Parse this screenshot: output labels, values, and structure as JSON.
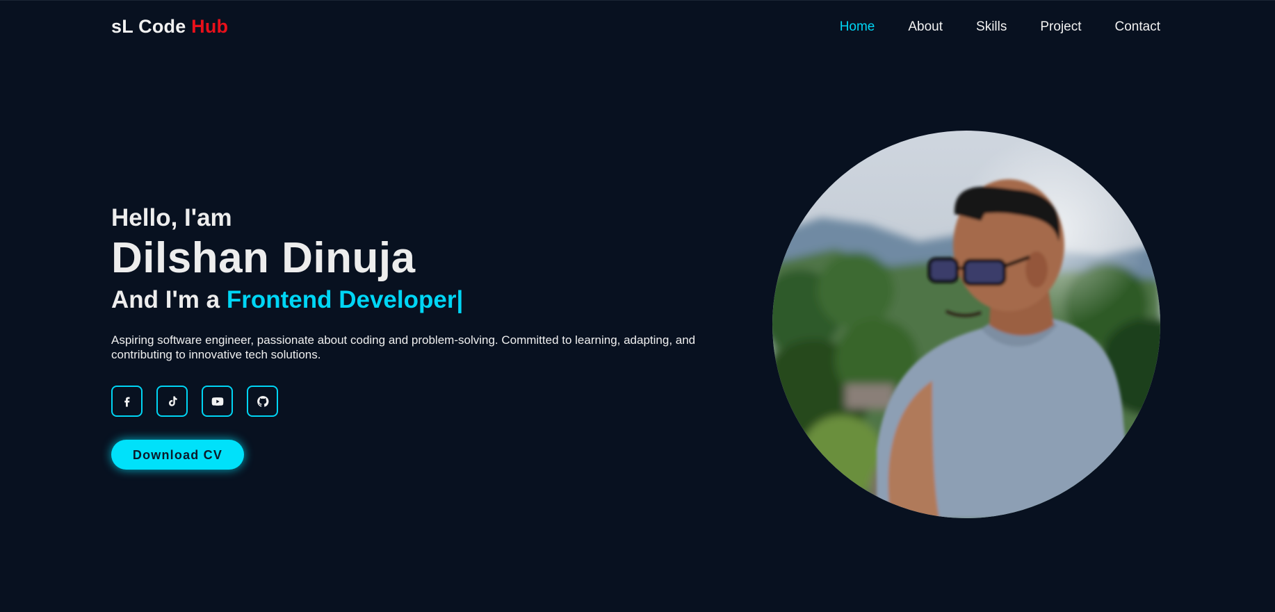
{
  "header": {
    "logo_main": "sL Code ",
    "logo_accent": "Hub",
    "nav": [
      {
        "label": "Home",
        "active": true
      },
      {
        "label": "About",
        "active": false
      },
      {
        "label": "Skills",
        "active": false
      },
      {
        "label": "Project",
        "active": false
      },
      {
        "label": "Contact",
        "active": false
      }
    ]
  },
  "hero": {
    "greeting": "Hello, I'am",
    "name": "Dilshan Dinuja",
    "role_prefix": "And I'm a ",
    "role": "Frontend Developer|",
    "bio": "Aspiring software engineer, passionate about coding and problem-solving. Committed to learning, adapting, and contributing to innovative tech solutions.",
    "socials": [
      {
        "icon": "facebook-icon"
      },
      {
        "icon": "tiktok-icon"
      },
      {
        "icon": "youtube-icon"
      },
      {
        "icon": "github-icon"
      }
    ],
    "cta_label": "Download CV"
  },
  "colors": {
    "background": "#081120",
    "accent": "#00d6f5",
    "logo_accent": "#e8101a",
    "text": "#ededed"
  }
}
